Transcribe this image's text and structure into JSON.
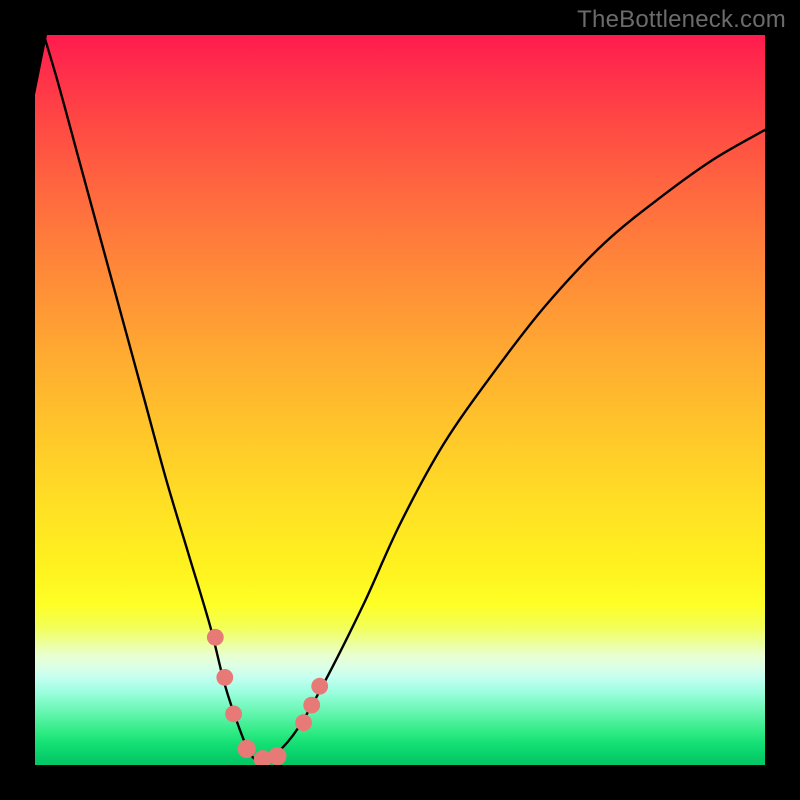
{
  "watermark": "TheBottleneck.com",
  "colors": {
    "frame": "#000000",
    "curve": "#000000",
    "marker_fill": "#e77a77",
    "marker_stroke": "#c85a58"
  },
  "chart_data": {
    "type": "line",
    "title": "",
    "xlabel": "",
    "ylabel": "",
    "xlim": [
      0,
      100
    ],
    "ylim": [
      0,
      100
    ],
    "grid": false,
    "legend": false,
    "series": [
      {
        "name": "curve",
        "x": [
          0,
          3,
          6,
          9,
          12,
          15,
          18,
          21,
          24,
          26,
          28,
          29.5,
          31,
          33,
          36,
          40,
          45,
          50,
          56,
          63,
          70,
          78,
          86,
          93,
          100
        ],
        "y": [
          104,
          94,
          83,
          72,
          61,
          50,
          39,
          29,
          19,
          11,
          5,
          1.5,
          0.5,
          1.5,
          5,
          12,
          22,
          33,
          44,
          54,
          63,
          71.5,
          78,
          83,
          87
        ]
      }
    ],
    "markers": [
      {
        "x": 24.7,
        "y": 17.5,
        "r": 1.2
      },
      {
        "x": 26.0,
        "y": 12.0,
        "r": 1.2
      },
      {
        "x": 27.2,
        "y": 7.0,
        "r": 1.2
      },
      {
        "x": 29.0,
        "y": 2.2,
        "r": 1.3
      },
      {
        "x": 31.2,
        "y": 0.8,
        "r": 1.3
      },
      {
        "x": 33.2,
        "y": 1.2,
        "r": 1.3
      },
      {
        "x": 36.8,
        "y": 5.8,
        "r": 1.2
      },
      {
        "x": 37.9,
        "y": 8.2,
        "r": 1.2
      },
      {
        "x": 39.0,
        "y": 10.8,
        "r": 1.2
      }
    ]
  }
}
